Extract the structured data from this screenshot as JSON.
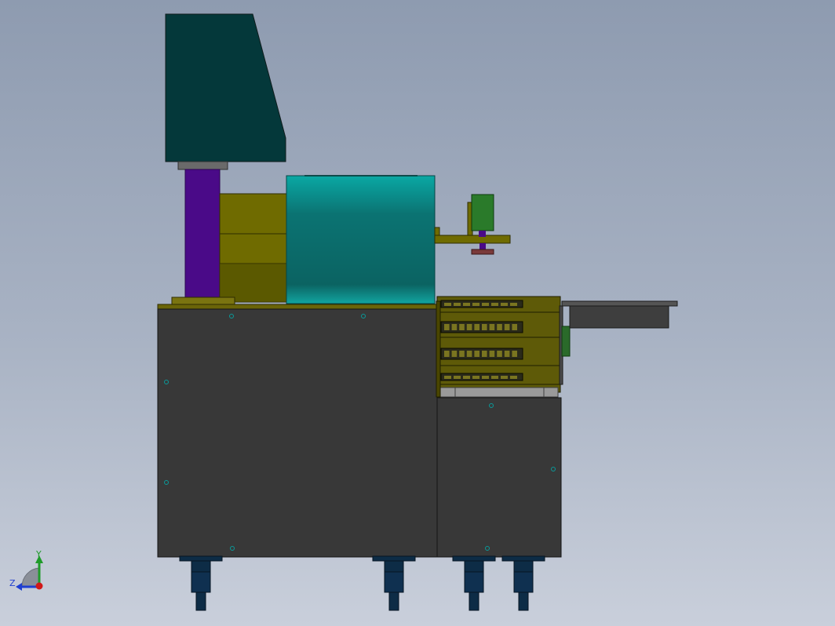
{
  "viewport": {
    "background_top": "#8e9bb0",
    "background_bottom": "#c9cfdb"
  },
  "triad": {
    "y_label": "Y",
    "z_label": "Z",
    "y_color": "#1f9b2a",
    "x_color": "#d11818",
    "z_color": "#1f3fd1"
  },
  "colors": {
    "hood": "#04383a",
    "column": "#4a0a88",
    "motor": "#6f6b00",
    "tank": "#0b7a78",
    "cabinet": "#383838",
    "rack": "#5e5a08",
    "mount": "#2a7a2a",
    "feet": "#0d2c46"
  }
}
